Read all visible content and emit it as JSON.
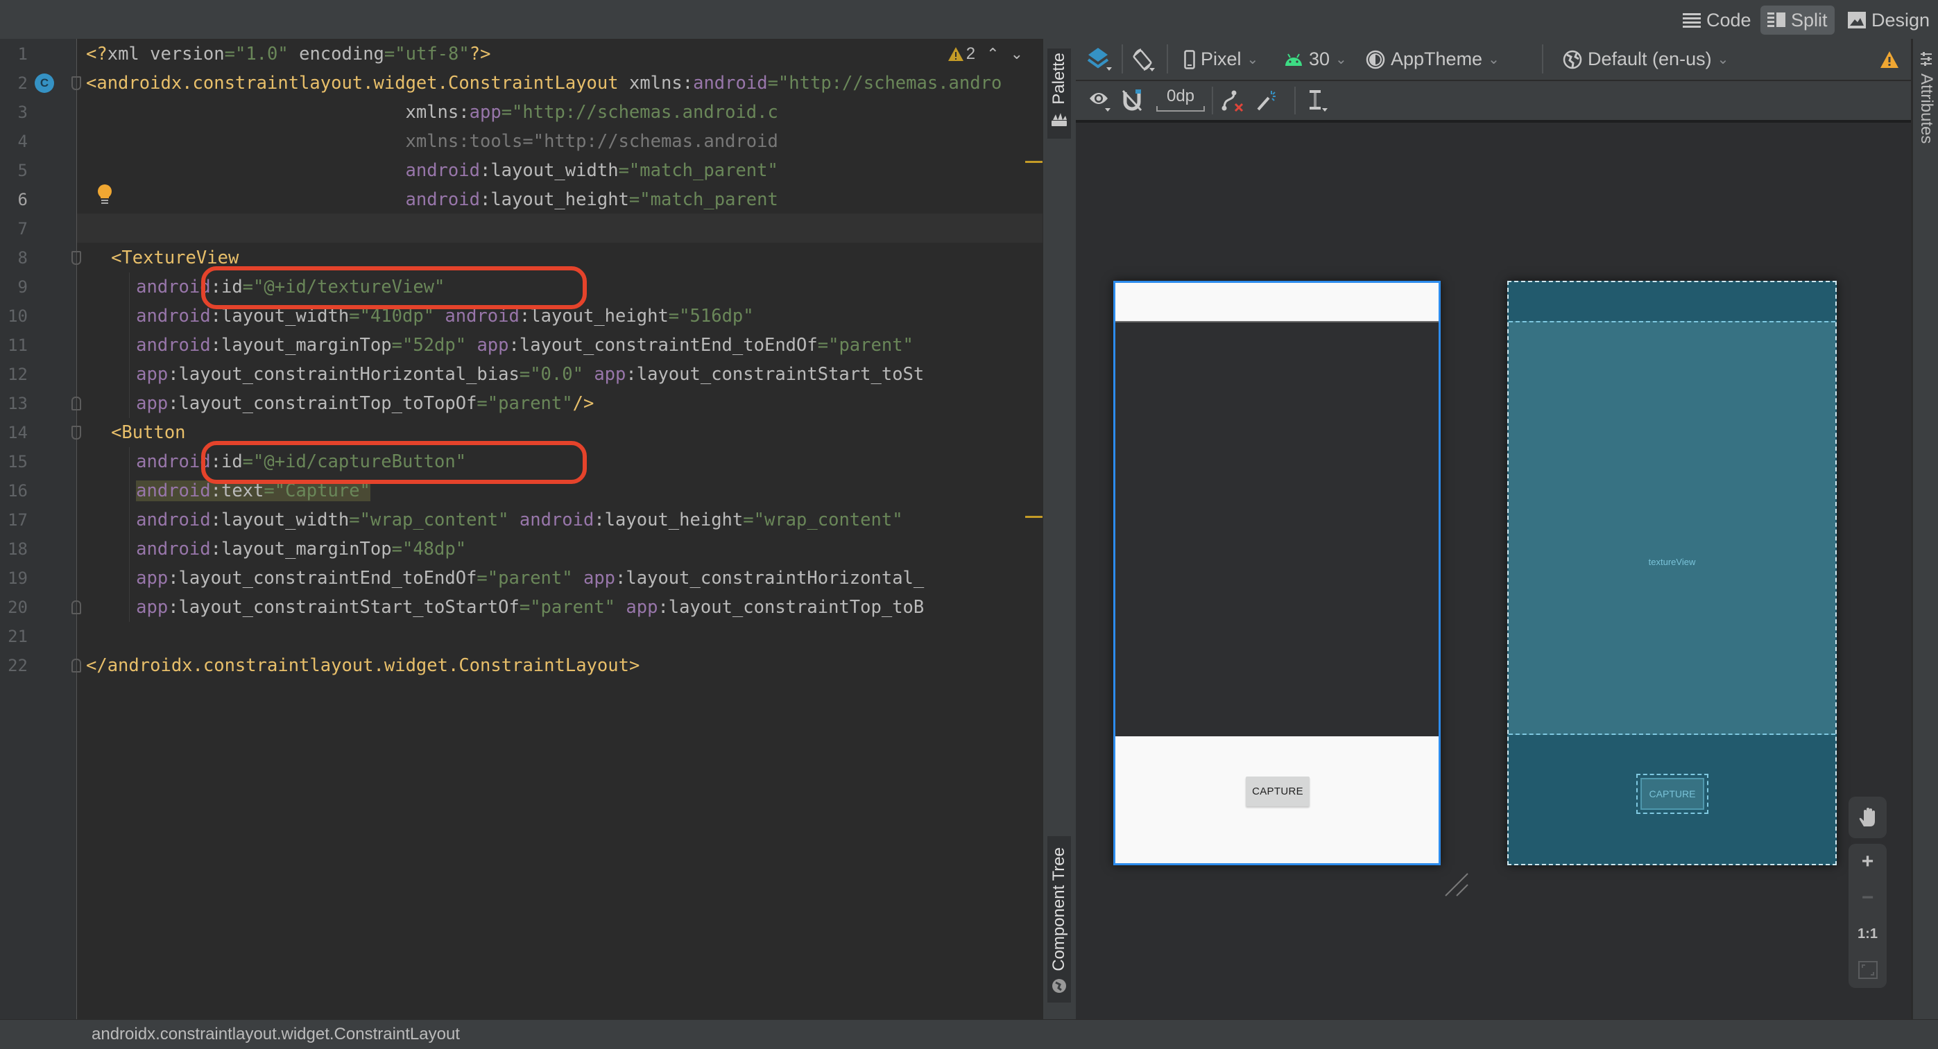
{
  "view_modes": [
    {
      "label": "Code",
      "icon": "lines-icon",
      "active": false
    },
    {
      "label": "Split",
      "icon": "split-icon",
      "active": true
    },
    {
      "label": "Design",
      "icon": "image-icon",
      "active": false
    }
  ],
  "editor": {
    "inspection_warning_count": "2",
    "current_line": 6,
    "line_numbers": [
      "1",
      "2",
      "3",
      "4",
      "5",
      "6",
      "7",
      "8",
      "9",
      "10",
      "11",
      "12",
      "13",
      "14",
      "15",
      "16",
      "17",
      "18",
      "19",
      "20",
      "21",
      "22"
    ],
    "lines": [
      {
        "n": 1,
        "indent": 0,
        "tokens": [
          [
            "t-tag",
            "<?"
          ],
          [
            "t-plain",
            "xml version"
          ],
          [
            "t-eq",
            "="
          ],
          [
            "t-val",
            "\"1.0\""
          ],
          [
            "t-plain",
            " encoding"
          ],
          [
            "t-eq",
            "="
          ],
          [
            "t-val",
            "\"utf-8\""
          ],
          [
            "t-tag",
            "?>"
          ]
        ]
      },
      {
        "n": 2,
        "indent": 0,
        "tokens": [
          [
            "t-tag",
            "<androidx.constraintlayout.widget.ConstraintLayout"
          ],
          [
            "t-plain",
            " xmlns:"
          ],
          [
            "t-ns",
            "android"
          ],
          [
            "t-eq",
            "="
          ],
          [
            "t-val",
            "\"http://schemas.andro"
          ]
        ]
      },
      {
        "n": 3,
        "indent": 19,
        "tokens": [
          [
            "t-plain",
            "xmlns:"
          ],
          [
            "t-ns",
            "app"
          ],
          [
            "t-eq",
            "="
          ],
          [
            "t-val",
            "\"http://schemas.android.c"
          ]
        ]
      },
      {
        "n": 4,
        "indent": 19,
        "tokens": [
          [
            "t-dim",
            "xmlns:tools=\"http://schemas.android"
          ]
        ]
      },
      {
        "n": 5,
        "indent": 19,
        "tokens": [
          [
            "t-ns",
            "android"
          ],
          [
            "t-plain",
            ":layout_width"
          ],
          [
            "t-eq",
            "="
          ],
          [
            "t-val",
            "\"match_parent\""
          ]
        ]
      },
      {
        "n": 6,
        "indent": 19,
        "tokens": [
          [
            "t-ns",
            "android"
          ],
          [
            "t-plain",
            ":layout_height"
          ],
          [
            "t-eq",
            "="
          ],
          [
            "t-val",
            "\"match_parent"
          ]
        ]
      },
      {
        "n": 7,
        "indent": 0,
        "tokens": []
      },
      {
        "n": 8,
        "indent": 1,
        "tokens": [
          [
            "t-tag",
            "<TextureView"
          ]
        ]
      },
      {
        "n": 9,
        "indent": 2,
        "tokens": [
          [
            "t-ns",
            "android"
          ],
          [
            "t-plain",
            ":id"
          ],
          [
            "t-eq",
            "="
          ],
          [
            "t-val",
            "\"@+id/textureView\""
          ]
        ]
      },
      {
        "n": 10,
        "indent": 2,
        "tokens": [
          [
            "t-ns",
            "android"
          ],
          [
            "t-plain",
            ":layout_width"
          ],
          [
            "t-eq",
            "="
          ],
          [
            "t-val",
            "\"410dp\""
          ],
          [
            "t-plain",
            " "
          ],
          [
            "t-ns",
            "android"
          ],
          [
            "t-plain",
            ":layout_height"
          ],
          [
            "t-eq",
            "="
          ],
          [
            "t-val",
            "\"516dp\""
          ]
        ]
      },
      {
        "n": 11,
        "indent": 2,
        "tokens": [
          [
            "t-ns",
            "android"
          ],
          [
            "t-plain",
            ":layout_marginTop"
          ],
          [
            "t-eq",
            "="
          ],
          [
            "t-val",
            "\"52dp\""
          ],
          [
            "t-plain",
            " "
          ],
          [
            "t-ns",
            "app"
          ],
          [
            "t-plain",
            ":layout_constraintEnd_toEndOf"
          ],
          [
            "t-eq",
            "="
          ],
          [
            "t-val",
            "\"parent\""
          ]
        ]
      },
      {
        "n": 12,
        "indent": 2,
        "tokens": [
          [
            "t-ns",
            "app"
          ],
          [
            "t-plain",
            ":layout_constraintHorizontal_bias"
          ],
          [
            "t-eq",
            "="
          ],
          [
            "t-val",
            "\"0.0\""
          ],
          [
            "t-plain",
            " "
          ],
          [
            "t-ns",
            "app"
          ],
          [
            "t-plain",
            ":layout_constraintStart_toSt"
          ]
        ]
      },
      {
        "n": 13,
        "indent": 2,
        "tokens": [
          [
            "t-ns",
            "app"
          ],
          [
            "t-plain",
            ":layout_constraintTop_toTopOf"
          ],
          [
            "t-eq",
            "="
          ],
          [
            "t-val",
            "\"parent\""
          ],
          [
            "t-tag",
            "/>"
          ]
        ]
      },
      {
        "n": 14,
        "indent": 1,
        "tokens": [
          [
            "t-tag",
            "<Button"
          ]
        ]
      },
      {
        "n": 15,
        "indent": 2,
        "tokens": [
          [
            "t-ns",
            "android"
          ],
          [
            "t-plain",
            ":id"
          ],
          [
            "t-eq",
            "="
          ],
          [
            "t-val",
            "\"@+id/captureButton\""
          ]
        ]
      },
      {
        "n": 16,
        "indent": 2,
        "highlight": true,
        "tokens": [
          [
            "t-ns",
            "android"
          ],
          [
            "t-plain",
            ":text"
          ],
          [
            "t-eq",
            "="
          ],
          [
            "t-val",
            "\"Capture\""
          ]
        ]
      },
      {
        "n": 17,
        "indent": 2,
        "tokens": [
          [
            "t-ns",
            "android"
          ],
          [
            "t-plain",
            ":layout_width"
          ],
          [
            "t-eq",
            "="
          ],
          [
            "t-val",
            "\"wrap_content\""
          ],
          [
            "t-plain",
            " "
          ],
          [
            "t-ns",
            "android"
          ],
          [
            "t-plain",
            ":layout_height"
          ],
          [
            "t-eq",
            "="
          ],
          [
            "t-val",
            "\"wrap_content\""
          ]
        ]
      },
      {
        "n": 18,
        "indent": 2,
        "tokens": [
          [
            "t-ns",
            "android"
          ],
          [
            "t-plain",
            ":layout_marginTop"
          ],
          [
            "t-eq",
            "="
          ],
          [
            "t-val",
            "\"48dp\""
          ]
        ]
      },
      {
        "n": 19,
        "indent": 2,
        "tokens": [
          [
            "t-ns",
            "app"
          ],
          [
            "t-plain",
            ":layout_constraintEnd_toEndOf"
          ],
          [
            "t-eq",
            "="
          ],
          [
            "t-val",
            "\"parent\""
          ],
          [
            "t-plain",
            " "
          ],
          [
            "t-ns",
            "app"
          ],
          [
            "t-plain",
            ":layout_constraintHorizontal_"
          ]
        ]
      },
      {
        "n": 20,
        "indent": 2,
        "tokens": [
          [
            "t-ns",
            "app"
          ],
          [
            "t-plain",
            ":layout_constraintStart_toStartOf"
          ],
          [
            "t-eq",
            "="
          ],
          [
            "t-val",
            "\"parent\""
          ],
          [
            "t-plain",
            " "
          ],
          [
            "t-ns",
            "app"
          ],
          [
            "t-plain",
            ":layout_constraintTop_toB"
          ]
        ]
      },
      {
        "n": 21,
        "indent": 0,
        "tokens": []
      },
      {
        "n": 22,
        "indent": 0,
        "tokens": [
          [
            "t-tag",
            "</androidx.constraintlayout.widget.ConstraintLayout>"
          ]
        ]
      }
    ],
    "annotations": [
      {
        "label": "textureView id highlight",
        "line": 9
      },
      {
        "label": "captureButton id highlight",
        "line": 15
      }
    ]
  },
  "side_tabs": {
    "palette": "Palette",
    "component_tree": "Component Tree",
    "attributes": "Attributes"
  },
  "design_toolbar": {
    "device": "Pixel",
    "api_level": "30",
    "theme": "AppTheme",
    "locale": "Default (en-us)",
    "default_margin": "0dp"
  },
  "preview": {
    "design_button_label": "CAPTURE",
    "blueprint_texture_label": "textureView",
    "blueprint_button_label": "CAPTURE"
  },
  "zoom_controls": {
    "zoom_in": "+",
    "zoom_out": "−",
    "actual_size": "1:1"
  },
  "status_bar": {
    "breadcrumb": "androidx.constraintlayout.widget.ConstraintLayout"
  },
  "colors": {
    "selection_blue": "#2d8ced",
    "blueprint_bg": "#225a6d",
    "blueprint_view": "#377283",
    "annotation_red": "#e5432b",
    "warning_yellow": "#f0a732",
    "android_green": "#3ddc84"
  }
}
